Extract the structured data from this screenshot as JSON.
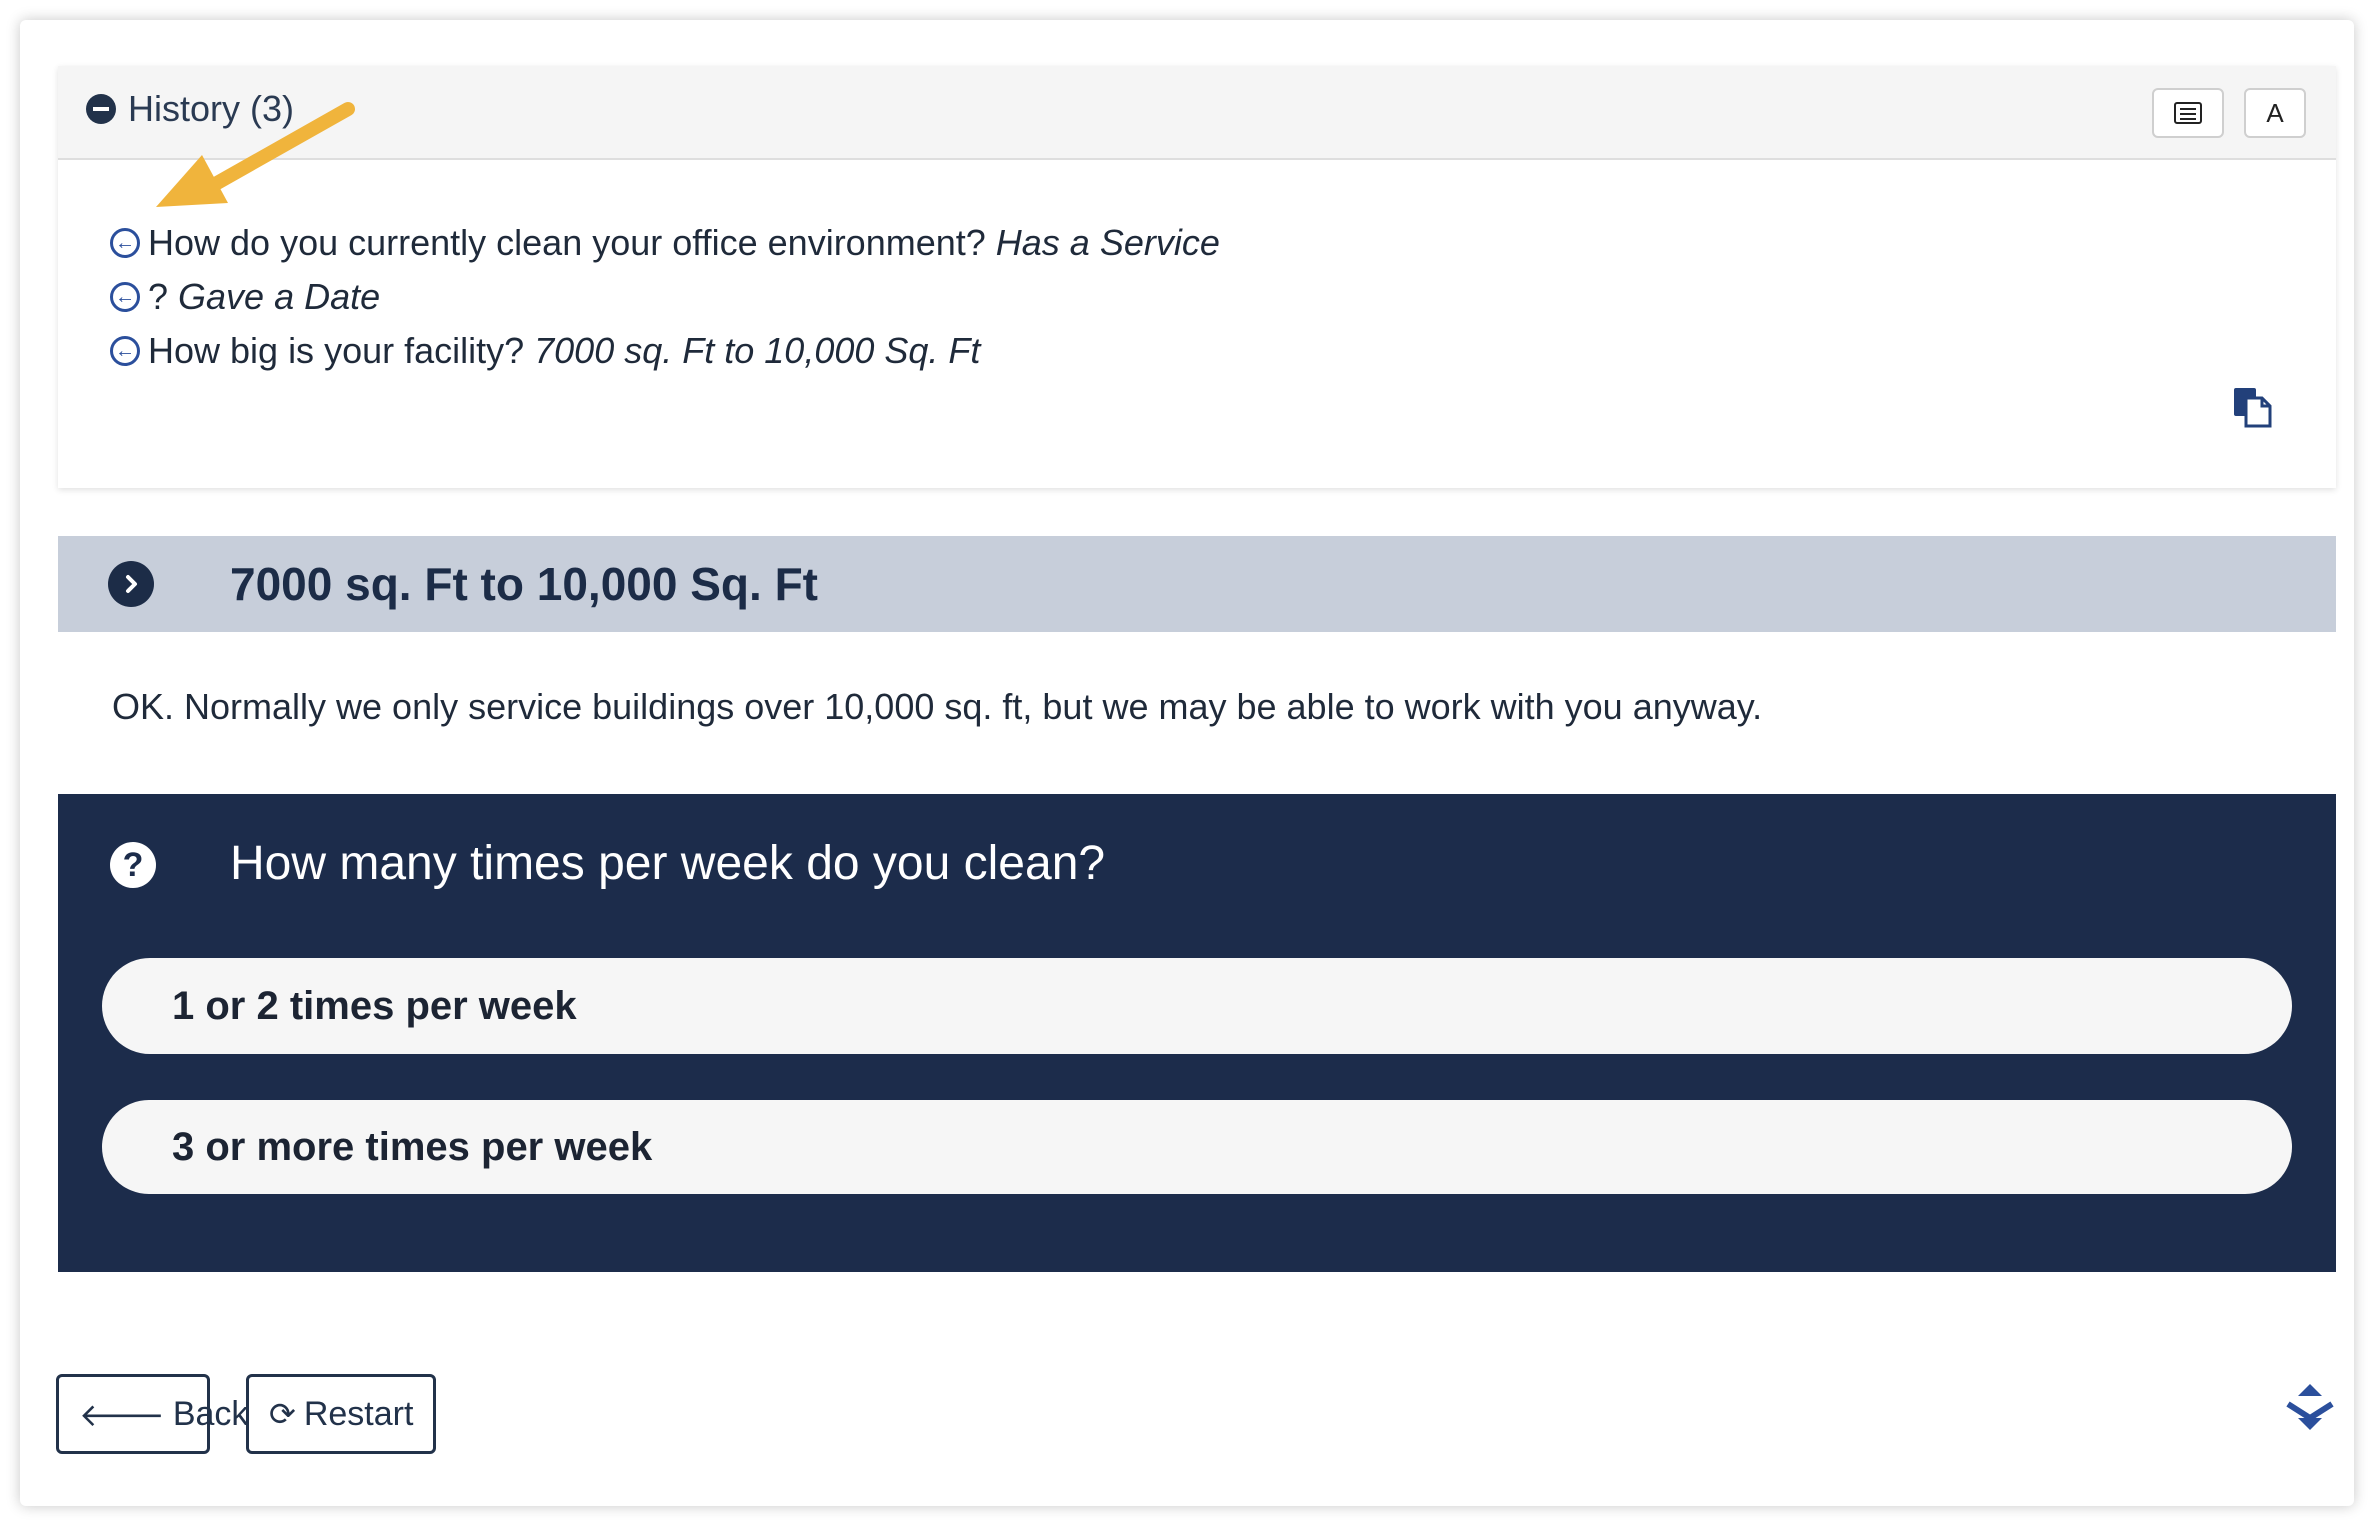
{
  "history": {
    "title": "History (3)",
    "font_button_label": "A",
    "items": [
      {
        "question": "How do you currently clean your office environment?",
        "answer": "Has a Service"
      },
      {
        "question": "?",
        "answer": "Gave a Date"
      },
      {
        "question": "How big is your facility?",
        "answer": "7000 sq. Ft to 10,000 Sq. Ft"
      }
    ]
  },
  "selected_answer": "7000 sq. Ft to 10,000 Sq. Ft",
  "response": "OK. Normally we only service buildings over 10,000 sq. ft, but we may be able to work with you anyway.",
  "question": {
    "text": "How many times per week do you clean?",
    "options": [
      "1 or 2 times per week",
      "3 or more times per week"
    ]
  },
  "footer": {
    "back_label": "Back",
    "restart_label": "Restart"
  },
  "colors": {
    "navy": "#1c2c4b",
    "answer_bar": "#c7ceda",
    "link_blue": "#2b4f9c",
    "annotation_arrow": "#f0b43c"
  }
}
